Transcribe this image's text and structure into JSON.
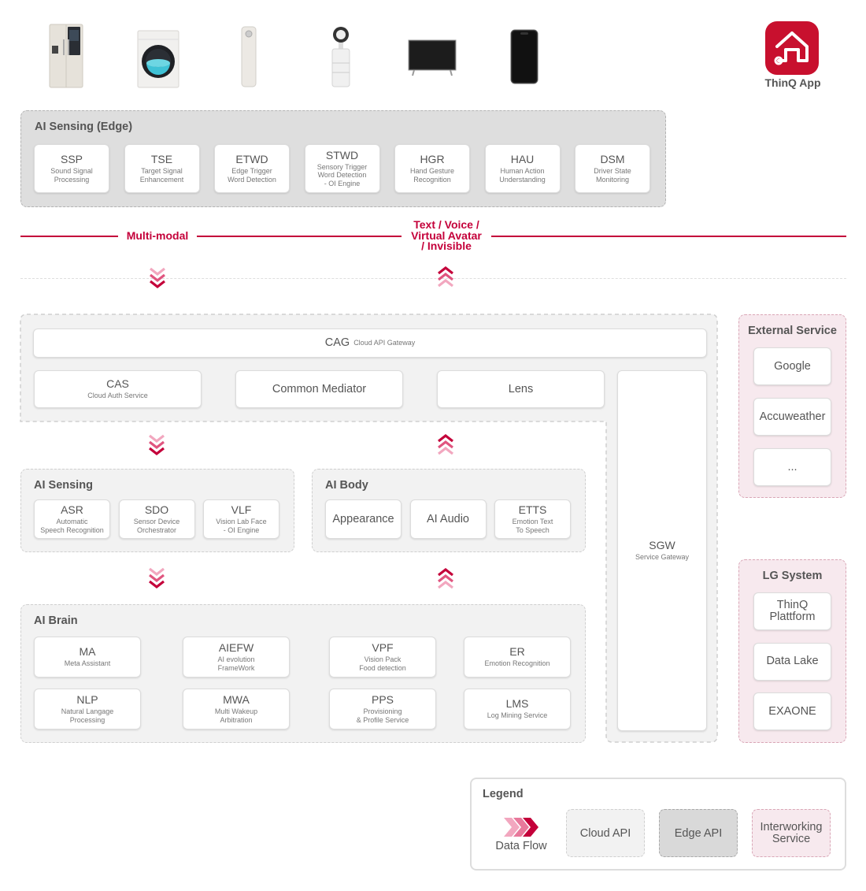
{
  "app": {
    "label": "ThinQ App",
    "brand_color": "#c8102e"
  },
  "edge": {
    "title": "AI Sensing (Edge)",
    "modules": [
      {
        "abbr": "SSP",
        "desc": "Sound Signal\nProcessing"
      },
      {
        "abbr": "TSE",
        "desc": "Target Signal\nEnhancement"
      },
      {
        "abbr": "ETWD",
        "desc": "Edge Trigger\nWord Detection"
      },
      {
        "abbr": "STWD",
        "desc": "Sensory Trigger\nWord Detection\n- OI Engine"
      },
      {
        "abbr": "HGR",
        "desc": "Hand Gesture\nRecognition"
      },
      {
        "abbr": "HAU",
        "desc": "Human Action\nUnderstanding"
      },
      {
        "abbr": "DSM",
        "desc": "Driver State\nMonitoring"
      }
    ]
  },
  "io": {
    "left": "Multi-modal",
    "right": "Text / Voice /\nVirtual Avatar\n/ Invisible"
  },
  "gateway": {
    "cag": {
      "abbr": "CAG",
      "desc": "Cloud API Gateway"
    },
    "cas": {
      "abbr": "CAS",
      "desc": "Cloud Auth Service"
    },
    "mediator": "Common Mediator",
    "lens": "Lens",
    "sgw": {
      "abbr": "SGW",
      "desc": "Service Gateway"
    }
  },
  "ai_sensing": {
    "title": "AI Sensing",
    "modules": [
      {
        "abbr": "ASR",
        "desc": "Automatic\nSpeech Recognition"
      },
      {
        "abbr": "SDO",
        "desc": "Sensor Device\nOrchestrator"
      },
      {
        "abbr": "VLF",
        "desc": "Vision Lab Face\n- OI Engine"
      }
    ]
  },
  "ai_body": {
    "title": "AI Body",
    "modules": [
      {
        "abbr": "Appearance",
        "desc": ""
      },
      {
        "abbr": "AI Audio",
        "desc": ""
      },
      {
        "abbr": "ETTS",
        "desc": "Emotion Text\nTo Speech"
      }
    ]
  },
  "ai_brain": {
    "title": "AI Brain",
    "modules": [
      {
        "abbr": "MA",
        "desc": "Meta Assistant"
      },
      {
        "abbr": "AIEFW",
        "desc": "AI evolution\nFrameWork"
      },
      {
        "abbr": "VPF",
        "desc": "Vision Pack\nFood detection"
      },
      {
        "abbr": "ER",
        "desc": "Emotion Recognition"
      },
      {
        "abbr": "NLP",
        "desc": "Natural Langage\nProcessing"
      },
      {
        "abbr": "MWA",
        "desc": "Multi Wakeup\nArbitration"
      },
      {
        "abbr": "PPS",
        "desc": "Provisioning\n& Profile Service"
      },
      {
        "abbr": "LMS",
        "desc": "Log Mining Service"
      }
    ]
  },
  "external": {
    "title": "External Service",
    "items": [
      "Google",
      "Accuweather",
      "..."
    ]
  },
  "lg_system": {
    "title": "LG System",
    "items": [
      "ThinQ\nPlattform",
      "Data Lake",
      "EXAONE"
    ]
  },
  "legend": {
    "title": "Legend",
    "data_flow": "Data Flow",
    "cloud": "Cloud API",
    "edge": "Edge API",
    "interworking": "Interworking\nService"
  },
  "colors": {
    "accent": "#c4003a",
    "arrow_down": "#c4003a",
    "arrow_up": "#e8789b",
    "cloud_bg": "#f2f2f2",
    "edge_bg": "#dedede",
    "interworking_bg": "#f7e9ee"
  }
}
